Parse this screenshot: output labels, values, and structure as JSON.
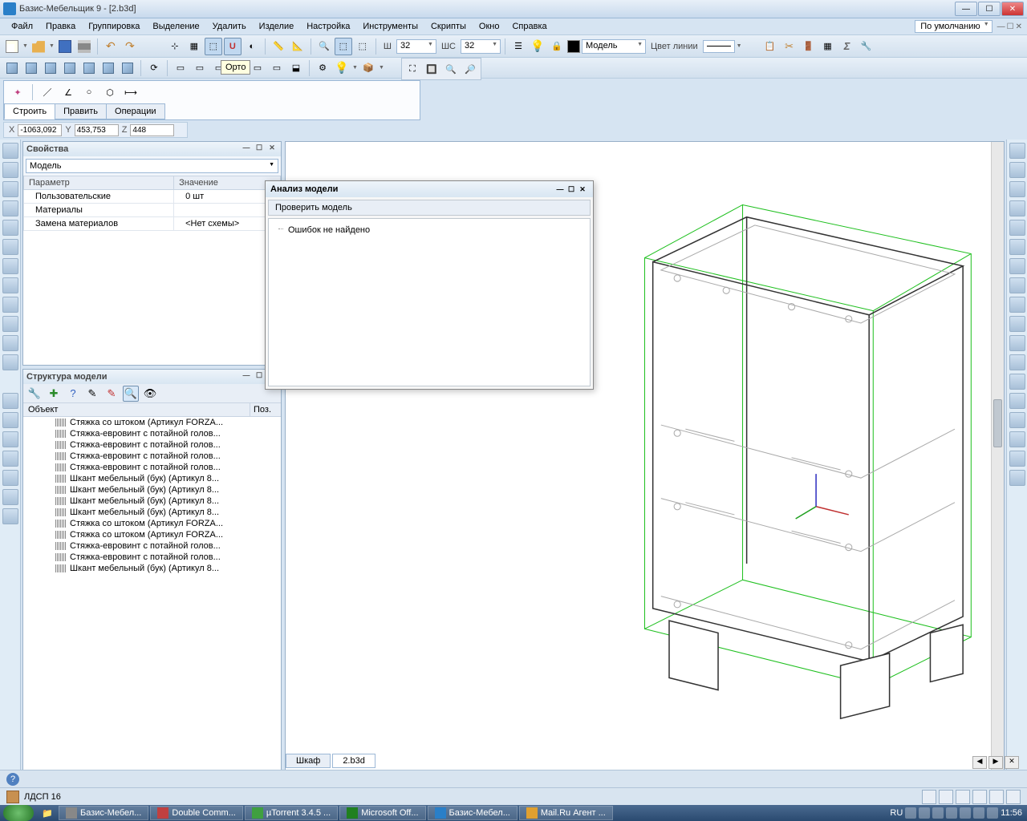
{
  "window": {
    "title": "Базис-Мебельщик 9 - [2.b3d]"
  },
  "menu": {
    "items": [
      "Файл",
      "Правка",
      "Группировка",
      "Выделение",
      "Удалить",
      "Изделие",
      "Настройка",
      "Инструменты",
      "Скрипты",
      "Окно",
      "Справка"
    ],
    "default_combo": "По умолчанию"
  },
  "tooltip": "Орто",
  "toolbar1": {
    "w_label": "Ш",
    "w_value": "32",
    "wc_label": "ШС",
    "wc_value": "32",
    "model_label": "Модель",
    "linecolor_label": "Цвет линии"
  },
  "draw_tabs": {
    "t1": "Строить",
    "t2": "Править",
    "t3": "Операции"
  },
  "coords": {
    "x_lbl": "X",
    "x": "-1063,092",
    "y_lbl": "Y",
    "y": "453,753",
    "z_lbl": "Z",
    "z": "448"
  },
  "props_panel": {
    "title": "Свойства",
    "combo": "Модель",
    "col_param": "Параметр",
    "col_value": "Значение",
    "rows": [
      {
        "p": "Пользовательские",
        "v": "0 шт"
      },
      {
        "p": "Материалы",
        "v": ""
      },
      {
        "p": "Замена материалов",
        "v": "<Нет схемы>"
      }
    ]
  },
  "struct_panel": {
    "title": "Структура модели",
    "col_obj": "Объект",
    "col_pos": "Поз.",
    "items": [
      "Стяжка со штоком (Артикул FORZA...",
      "Стяжка-евровинт с потайной голов...",
      "Стяжка-евровинт с потайной голов...",
      "Стяжка-евровинт с потайной голов...",
      "Стяжка-евровинт с потайной голов...",
      "Шкант мебельный (бук) (Артикул 8...",
      "Шкант мебельный (бук) (Артикул 8...",
      "Шкант мебельный (бук) (Артикул 8...",
      "Шкант мебельный (бук) (Артикул 8...",
      "Стяжка со штоком (Артикул FORZA...",
      "Стяжка со штоком (Артикул FORZA...",
      "Стяжка-евровинт с потайной голов...",
      "Стяжка-евровинт с потайной голов...",
      "Шкант мебельный (бук) (Артикул 8..."
    ]
  },
  "analysis": {
    "title": "Анализ модели",
    "action": "Проверить модель",
    "result": "Ошибок не найдено"
  },
  "bottom_tabs": {
    "t1": "Шкаф",
    "t2": "2.b3d"
  },
  "material_bar": {
    "label": "ЛДСП 16"
  },
  "taskbar": {
    "items": [
      "Базис-Мебел...",
      "Double Comm...",
      "µTorrent 3.4.5 ...",
      "Microsoft Off...",
      "Базис-Мебел...",
      "Mail.Ru Агент ..."
    ],
    "lang": "RU",
    "time": "11:56"
  }
}
